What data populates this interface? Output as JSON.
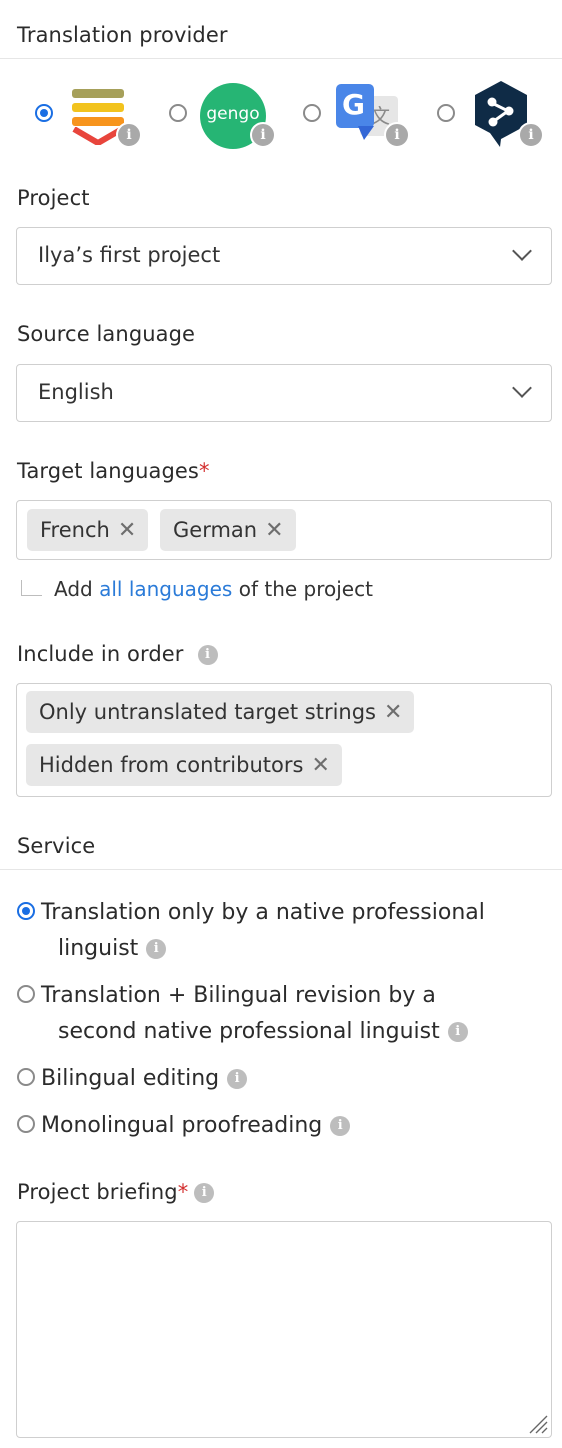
{
  "provider_section": {
    "title": "Translation provider",
    "providers": [
      {
        "name": "Lokalise",
        "icon": "lokalise-logo-icon",
        "selected": true
      },
      {
        "name": "Gengo",
        "icon": "gengo-logo-icon",
        "logo_text": "gengo",
        "selected": false
      },
      {
        "name": "Google Translate",
        "icon": "google-translate-logo-icon",
        "selected": false
      },
      {
        "name": "DeepL",
        "icon": "deepl-logo-icon",
        "selected": false
      }
    ]
  },
  "project": {
    "label": "Project",
    "value": "Ilya’s first project"
  },
  "source_language": {
    "label": "Source language",
    "value": "English"
  },
  "target_languages": {
    "label": "Target languages",
    "required_mark": "*",
    "chips": [
      "French",
      "German"
    ],
    "hint_prefix": "Add",
    "hint_link": "all languages",
    "hint_suffix": "of the project"
  },
  "include_in_order": {
    "label": "Include in order",
    "chips": [
      "Only untranslated target strings",
      "Hidden from contributors"
    ]
  },
  "service": {
    "title": "Service",
    "options": [
      {
        "line1": "Translation only by a native professional",
        "line2": "linguist",
        "selected": true
      },
      {
        "line1": "Translation + Bilingual revision by a",
        "line2": "second native professional linguist",
        "selected": false
      },
      {
        "line1": "Bilingual editing",
        "selected": false
      },
      {
        "line1": "Monolingual proofreading",
        "selected": false
      }
    ]
  },
  "briefing": {
    "label": "Project briefing",
    "required_mark": "*",
    "value": ""
  },
  "colors": {
    "accent": "#1a6ee3",
    "link": "#2b7bd8",
    "required": "#d32f2f"
  }
}
